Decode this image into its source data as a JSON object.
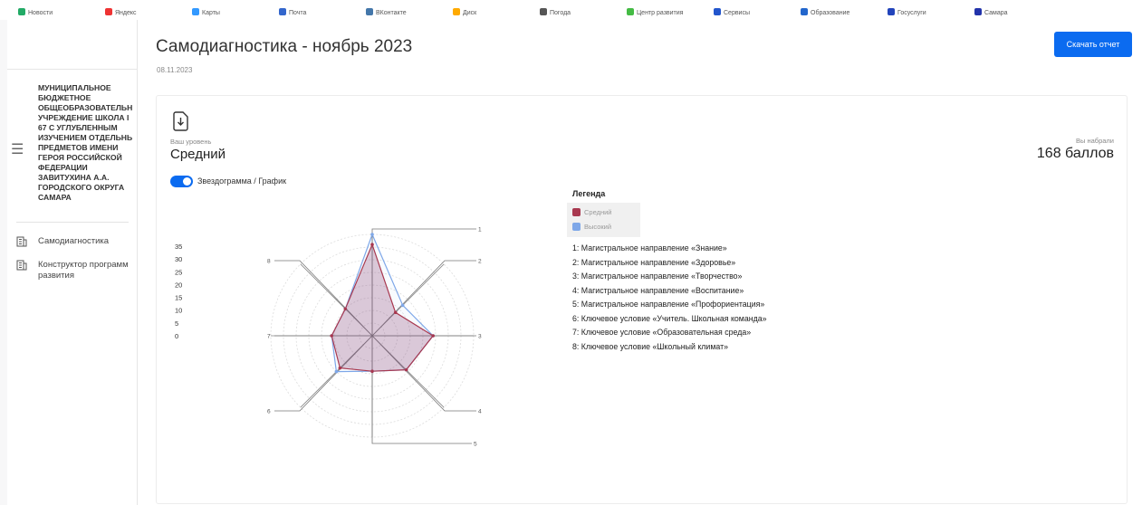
{
  "page": {
    "title": "Самодиагностика - ноябрь 2023",
    "date": "08.11.2023",
    "download_label": "Скачать отчет"
  },
  "sidebar": {
    "org_name": "МУНИЦИПАЛЬНОЕ БЮДЖЕТНОЕ ОБЩЕОБРАЗОВАТЕЛЬН УЧРЕЖДЕНИЕ ШКОЛА I 67 С УГЛУБЛЕННЫМ ИЗУЧЕНИЕМ ОТДЕЛЬНЬ ПРЕДМЕТОВ ИМЕНИ ГЕРОЯ РОССИЙСКОЙ ФЕДЕРАЦИИ ЗАВИТУХИНА А.А. ГОРОДСКОГО ОКРУГА САМАРА",
    "items": [
      {
        "label": "Самодиагностика",
        "icon": "building-icon"
      },
      {
        "label": "Конструктор программ развития",
        "icon": "building-icon"
      }
    ]
  },
  "result": {
    "level_caption": "Ваш уровень",
    "level": "Средний",
    "score_caption": "Вы набрали",
    "score": "168 баллов",
    "toggle_label": "Звездограмма / График"
  },
  "legend": {
    "title": "Легенда",
    "series": [
      {
        "name": "Средний",
        "color": "#a8384f"
      },
      {
        "name": "Высокий",
        "color": "#7ea7e8"
      }
    ],
    "axes": [
      "1: Магистральное направление «Знание»",
      "2: Магистральное направление «Здоровье»",
      "3: Магистральное направление «Творчество»",
      "4: Магистральное направление «Воспитание»",
      "5: Магистральное направление «Профориентация»",
      "6: Ключевое условие «Учитель. Школьная команда»",
      "7: Ключевое условие «Образовательная среда»",
      "8: Ключевое условие «Школьный климат»"
    ]
  },
  "chart_data": {
    "type": "radar",
    "categories": [
      "1",
      "2",
      "3",
      "4",
      "5",
      "6",
      "7",
      "8"
    ],
    "ylim": [
      0,
      40
    ],
    "ticks": [
      0,
      5,
      10,
      15,
      20,
      25,
      30,
      35
    ],
    "series": [
      {
        "name": "Средний",
        "values": [
          36,
          13,
          24,
          19,
          14,
          18,
          16,
          15
        ]
      },
      {
        "name": "Высокий",
        "values": [
          40,
          17,
          24,
          19,
          14,
          20,
          16,
          15
        ]
      }
    ]
  },
  "bookmarks": [
    {
      "label": "Новости",
      "color": "#2a6"
    },
    {
      "label": "Яндекс",
      "color": "#e33"
    },
    {
      "label": "Карты",
      "color": "#39f"
    },
    {
      "label": "Почта",
      "color": "#36c"
    },
    {
      "label": "ВКонтакте",
      "color": "#47a"
    },
    {
      "label": "Диск",
      "color": "#fa0"
    },
    {
      "label": "Погода",
      "color": "#555"
    },
    {
      "label": "Центр развития",
      "color": "#4b4"
    },
    {
      "label": "Сервисы",
      "color": "#25c"
    },
    {
      "label": "Образование",
      "color": "#26c"
    },
    {
      "label": "Госуслуги",
      "color": "#24b"
    },
    {
      "label": "Самара",
      "color": "#23a"
    }
  ]
}
